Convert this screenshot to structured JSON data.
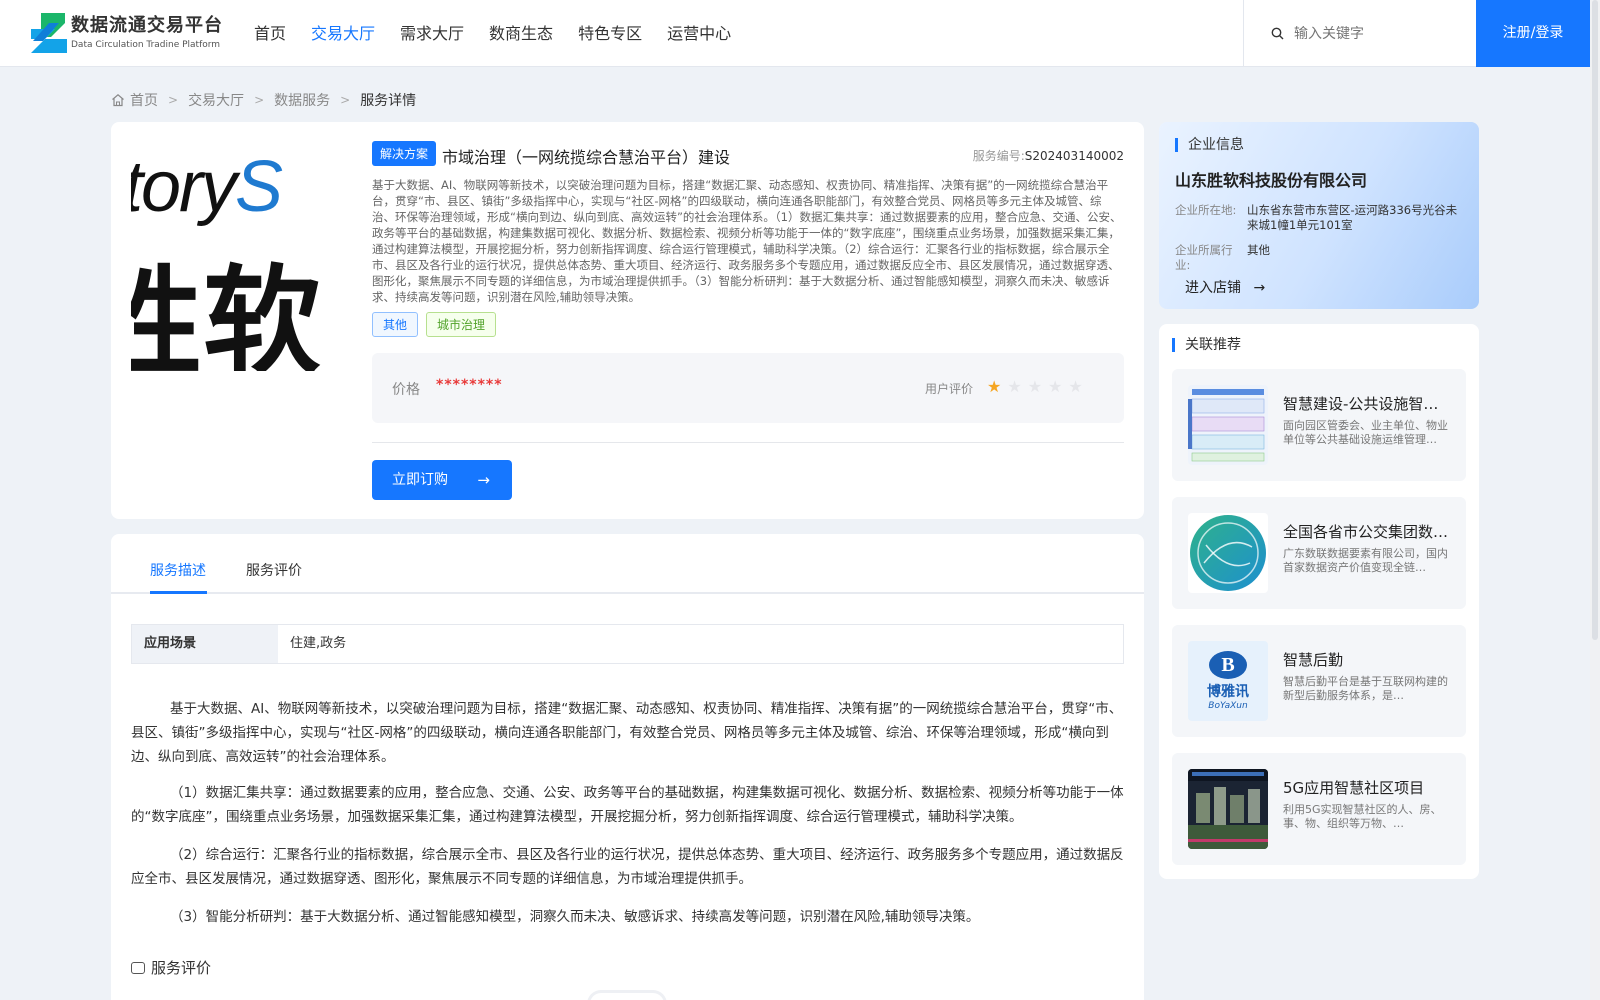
{
  "header": {
    "logo_cn": "数据流通交易平台",
    "logo_en": "Data Circulation Tradine Platform",
    "nav": [
      "首页",
      "交易大厅",
      "需求大厅",
      "数商生态",
      "特色专区",
      "运营中心"
    ],
    "active_nav": "交易大厅",
    "search_placeholder": "输入关键字",
    "login_label": "注册/登录"
  },
  "breadcrumb": [
    "首页",
    "交易大厅",
    "数据服务",
    "服务详情"
  ],
  "product": {
    "image_text_1a": "ctory",
    "image_text_1b": "S",
    "image_text_2": "胜软",
    "badge": "解决方案",
    "title": "市域治理（一网统揽综合慧治平台）建设",
    "service_no_label": "服务编号:",
    "service_no": "S202403140002",
    "description": "基于大数据、AI、物联网等新技术，以突破治理问题为目标，搭建“数据汇聚、动态感知、权责协同、精准指挥、决策有据”的一网统揽综合慧治平台，贯穿“市、县区、镇街”多级指挥中心，实现与“社区-网格”的四级联动，横向连通各职能部门，有效整合党员、网格员等多元主体及城管、综治、环保等治理领域，形成“横向到边、纵向到底、高效运转”的社会治理体系。（1）数据汇集共享：通过数据要素的应用，整合应急、交通、公安、政务等平台的基础数据，构建集数据可视化、数据分析、数据检索、视频分析等功能于一体的“数字底座”，围绕重点业务场景，加强数据采集汇集，通过构建算法模型，开展挖掘分析，努力创新指挥调度、综合运行管理模式，辅助科学决策。（2）综合运行：汇聚各行业的指标数据，综合展示全市、县区及各行业的运行状况，提供总体态势、重大项目、经济运行、政务服务多个专题应用，通过数据反应全市、县区发展情况，通过数据穿透、图形化，聚焦展示不同专题的详细信息，为市域治理提供抓手。（3）智能分析研判：基于大数据分析、通过智能感知模型，洞察久而未决、敏感诉求、持续高发等问题，识别潜在风险,辅助领导决策。",
    "tags": [
      "其他",
      "城市治理"
    ],
    "price_label": "价格",
    "price_value": "********",
    "rating_label": "用户评价",
    "rating": 1,
    "rating_max": 5,
    "buy_label": "立即订购"
  },
  "company": {
    "section_title": "企业信息",
    "name": "山东胜软科技股份有限公司",
    "location_label": "企业所在地:",
    "location": "山东省东营市东营区-运河路336号光谷未来城1幢1单元101室",
    "industry_label": "企业所属行业:",
    "industry": "其他",
    "enter_label": "进入店铺"
  },
  "recommend": {
    "section_title": "关联推荐",
    "items": [
      {
        "title": "智慧建设-公共设施智慧运维",
        "desc": "面向园区管委会、业主单位、物业单位等公共基础设施运维管理…"
      },
      {
        "title": "全国各省市公交集团数据服务",
        "desc": "广东数联数据要素有限公司，国内首家数据资产价值变现全链…"
      },
      {
        "title": "智慧后勤",
        "desc": "智慧后勤平台是基于互联网构建的新型后勤服务体系，是…"
      },
      {
        "title": "5G应用智慧社区项目",
        "desc": "利用5G实现智慧社区的人、房、事、物、组织等万物、…"
      }
    ],
    "thumb_3_text_cn": "博雅讯",
    "thumb_3_text_en": "BoYaXun"
  },
  "detail": {
    "tabs": [
      "服务描述",
      "服务评价"
    ],
    "scene_label": "应用场景",
    "scene_value": "住建,政务",
    "paragraphs": [
      "基于大数据、AI、物联网等新技术，以突破治理问题为目标，搭建“数据汇聚、动态感知、权责协同、精准指挥、决策有据”的一网统揽综合慧治平台，贯穿“市、县区、镇街”多级指挥中心，实现与“社区-网格”的四级联动，横向连通各职能部门，有效整合党员、网格员等多元主体及城管、综治、环保等治理领域，形成“横向到边、纵向到底、高效运转”的社会治理体系。",
      "（1）数据汇集共享：通过数据要素的应用，整合应急、交通、公安、政务等平台的基础数据，构建集数据可视化、数据分析、数据检索、视频分析等功能于一体的“数字底座”，围绕重点业务场景，加强数据采集汇集，通过构建算法模型，开展挖掘分析，努力创新指挥调度、综合运行管理模式，辅助科学决策。",
      "（2）综合运行：汇聚各行业的指标数据，综合展示全市、县区及各行业的运行状况，提供总体态势、重大项目、经济运行、政务服务多个专题应用，通过数据反应全市、县区发展情况，通过数据穿透、图形化，聚焦展示不同专题的详细信息，为市域治理提供抓手。",
      "（3）智能分析研判：基于大数据分析、通过智能感知模型，洞察久而未决、敏感诉求、持续高发等问题，识别潜在风险,辅助领导决策。"
    ],
    "review_title": "服务评价"
  },
  "colors": {
    "primary": "#1677ff",
    "price": "#e83a3a",
    "star": "#f5a623"
  }
}
